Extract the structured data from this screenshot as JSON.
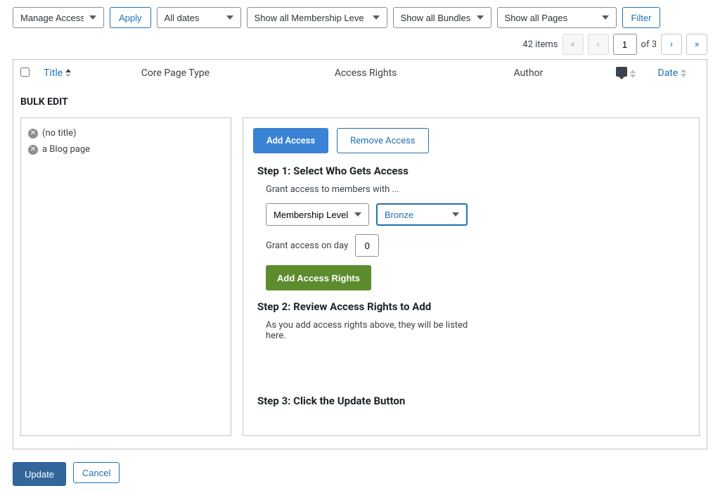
{
  "toolbar": {
    "bulk_action": "Manage Access",
    "apply": "Apply",
    "dates": "All dates",
    "membership": "Show all Membership Leve",
    "bundles": "Show all Bundles",
    "pages": "Show all Pages",
    "filter": "Filter"
  },
  "pagination": {
    "count": "42 items",
    "current": "1",
    "of": "of 3"
  },
  "columns": {
    "title": "Title",
    "type": "Core Page Type",
    "access": "Access Rights",
    "author": "Author",
    "date": "Date"
  },
  "bulk_label": "BULK EDIT",
  "items": [
    "(no title)",
    "a Blog page"
  ],
  "tabs": {
    "add": "Add Access",
    "remove": "Remove Access"
  },
  "step1": {
    "title": "Step 1: Select Who Gets Access",
    "grant_text": "Grant access to members with ...",
    "level_label": "Membership Level",
    "level_value": "Bronze",
    "day_label": "Grant access on day",
    "day_value": "0",
    "add_btn": "Add Access Rights"
  },
  "step2": {
    "title": "Step 2: Review Access Rights to Add",
    "text": "As you add access rights above, they will be listed here."
  },
  "step3": {
    "title": "Step 3: Click the Update Button"
  },
  "footer": {
    "update": "Update",
    "cancel": "Cancel"
  }
}
